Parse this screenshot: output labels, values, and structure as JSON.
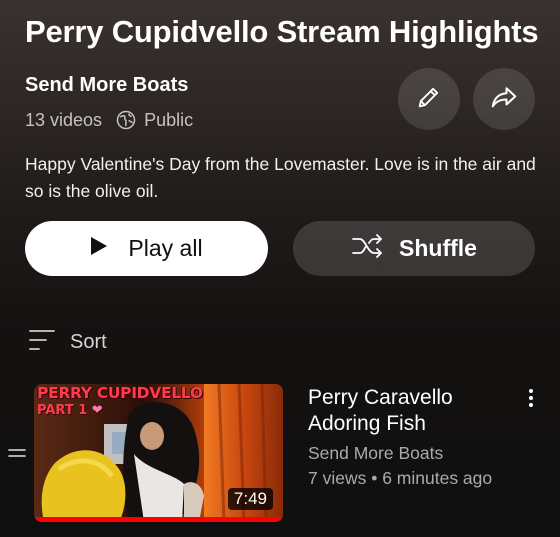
{
  "playlist": {
    "title": "Perry Cupidvello Stream Highlights",
    "channel": "Send More Boats",
    "video_count": "13 videos",
    "visibility": "Public",
    "description": "Happy Valentine's Day from the Lovemaster. Love is in the air and so is the olive oil."
  },
  "actions": {
    "play_all_label": "Play all",
    "shuffle_label": "Shuffle",
    "edit_icon": "pencil-icon",
    "share_icon": "share-arrow-icon"
  },
  "sort": {
    "label": "Sort",
    "icon": "sort-lines-icon"
  },
  "videos": [
    {
      "title": "Perry Caravello Adoring Fish",
      "channel": "Send More Boats",
      "stats": "7 views • 6 minutes ago",
      "duration": "7:49",
      "thumbnail_text_line1": "PERRY CUPIDVELLO",
      "thumbnail_text_line2": "PART 1",
      "watched_fraction": 1.0
    }
  ],
  "colors": {
    "progress": "#ff0000",
    "thumb_text": "#ff3b4d",
    "secondary_text": "#aaaaaa"
  }
}
